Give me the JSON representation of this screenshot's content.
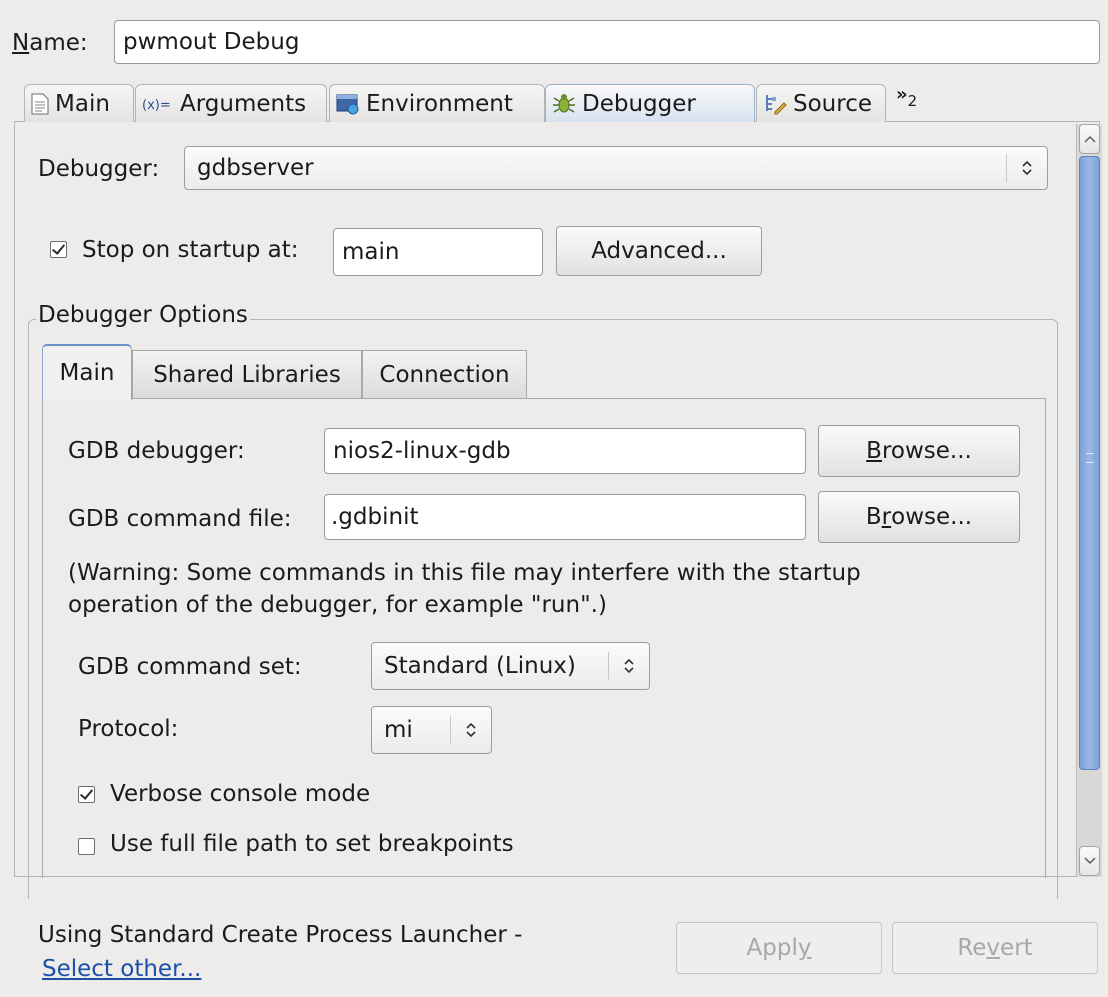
{
  "name_label_prefix": "N",
  "name_label_rest": "ame:",
  "name_value": "pwmout Debug",
  "tabs": [
    {
      "label": "Main",
      "icon": "document-icon"
    },
    {
      "label": "Arguments",
      "icon": "arguments-icon"
    },
    {
      "label": "Environment",
      "icon": "environment-icon"
    },
    {
      "label": "Debugger",
      "icon": "bug-icon",
      "active": true
    },
    {
      "label": "Source",
      "icon": "source-icon"
    }
  ],
  "tabs_overflow_count": "2",
  "debugger_label": "Debugger:",
  "debugger_value": "gdbserver",
  "stop_on_startup": {
    "label": "Stop on startup at:",
    "checked": true,
    "value": "main"
  },
  "advanced_button": "Advanced...",
  "options_group": {
    "title": "Debugger Options",
    "subtabs": [
      "Main",
      "Shared Libraries",
      "Connection"
    ],
    "gdb_debugger_label": "GDB debugger:",
    "gdb_debugger_value": "nios2-linux-gdb",
    "browse1": {
      "before": "",
      "mnemonic": "B",
      "after": "rowse..."
    },
    "gdb_command_file_label": "GDB command file:",
    "gdb_command_file_value": ".gdbinit",
    "browse2": {
      "before": "B",
      "mnemonic": "r",
      "after": "owse..."
    },
    "warning_line1": "(Warning: Some commands in this file may interfere with the startup",
    "warning_line2": "operation of the debugger, for example \"run\".)",
    "command_set_label": "GDB command set:",
    "command_set_value": "Standard (Linux)",
    "protocol_label": "Protocol:",
    "protocol_value": "mi",
    "verbose": {
      "label": "Verbose console mode",
      "checked": true
    },
    "full_path": {
      "label": "Use full file path to set breakpoints",
      "checked": false
    }
  },
  "footer": {
    "launcher_text": "Using Standard Create Process Launcher -",
    "select_other": "Select other...",
    "apply": {
      "before": "Appl",
      "mnemonic": "y",
      "after": ""
    },
    "revert": {
      "before": "Re",
      "mnemonic": "v",
      "after": "ert"
    }
  }
}
